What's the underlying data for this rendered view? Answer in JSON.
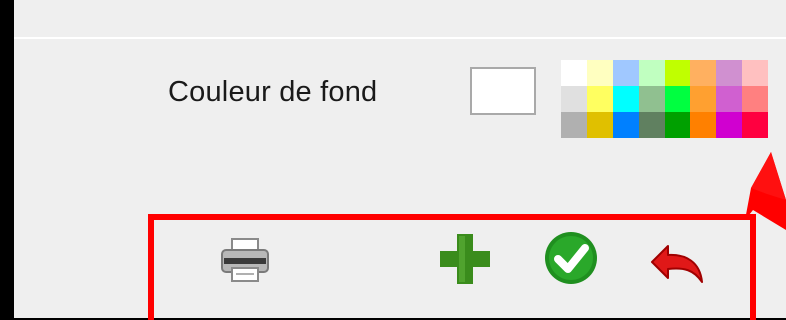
{
  "background_label": "Couleur de fond",
  "current_color": "#ffffff",
  "palette": [
    "#ffffff",
    "#ffffc0",
    "#a0c8ff",
    "#c0ffc0",
    "#c0ff00",
    "#ffb060",
    "#d090d0",
    "#ffc0c0",
    "#e0e0e0",
    "#ffff60",
    "#00ffff",
    "#90c090",
    "#00ff40",
    "#ffa030",
    "#d060d0",
    "#ff8080",
    "#b0b0b0",
    "#e0c000",
    "#0080ff",
    "#608060",
    "#00a000",
    "#ff8000",
    "#d000d0",
    "#ff0040"
  ],
  "toolbar": {
    "print_icon": "printer-icon",
    "add_icon": "plus-icon",
    "confirm_icon": "checkmark-icon",
    "undo_icon": "undo-arrow-icon"
  },
  "colors": {
    "highlight": "#ff0000",
    "add": "#3a8c1c",
    "confirm": "#1f8f1f",
    "undo": "#e01818"
  }
}
